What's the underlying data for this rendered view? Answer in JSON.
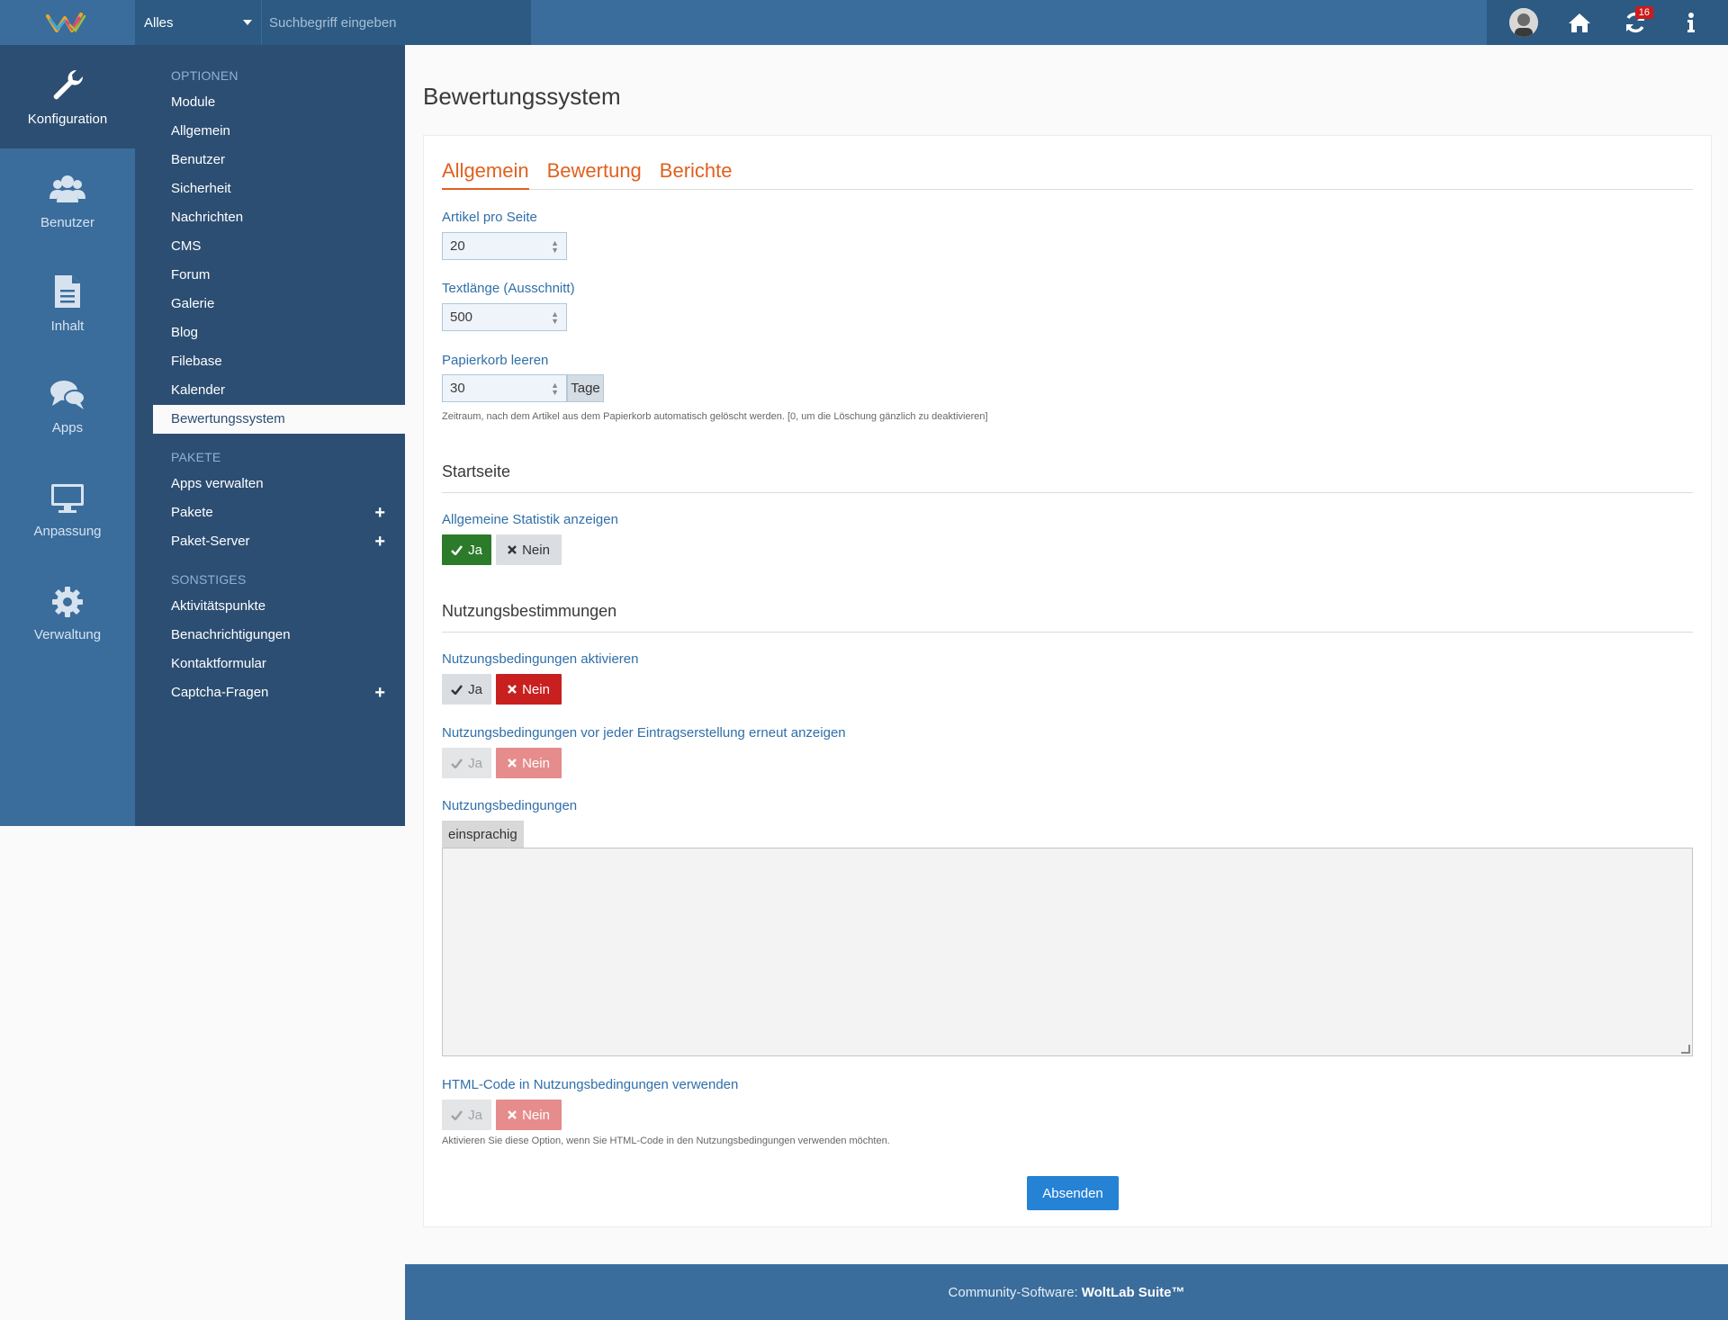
{
  "header": {
    "search_scope": "Alles",
    "search_placeholder": "Suchbegriff eingeben",
    "notification_count": "16"
  },
  "rail": {
    "items": [
      {
        "label": "Konfiguration",
        "icon": "wrench-icon"
      },
      {
        "label": "Benutzer",
        "icon": "users-icon"
      },
      {
        "label": "Inhalt",
        "icon": "file-icon"
      },
      {
        "label": "Apps",
        "icon": "comments-icon"
      },
      {
        "label": "Anpassung",
        "icon": "monitor-icon"
      },
      {
        "label": "Verwaltung",
        "icon": "gear-icon"
      }
    ]
  },
  "subnav": {
    "sections": [
      {
        "title": "OPTIONEN",
        "items": [
          "Module",
          "Allgemein",
          "Benutzer",
          "Sicherheit",
          "Nachrichten",
          "CMS",
          "Forum",
          "Galerie",
          "Blog",
          "Filebase",
          "Kalender",
          "Bewertungssystem"
        ]
      },
      {
        "title": "PAKETE",
        "items": [
          "Apps verwalten",
          "Pakete",
          "Paket-Server"
        ]
      },
      {
        "title": "SONSTIGES",
        "items": [
          "Aktivitätspunkte",
          "Benachrichtigungen",
          "Kontaktformular",
          "Captcha-Fragen"
        ]
      }
    ]
  },
  "page": {
    "title": "Bewertungssystem",
    "tabs": [
      "Allgemein",
      "Bewertung",
      "Berichte"
    ],
    "fields": {
      "artikel_label": "Artikel pro Seite",
      "artikel_value": "20",
      "textlaenge_label": "Textlänge (Ausschnitt)",
      "textlaenge_value": "500",
      "papierkorb_label": "Papierkorb leeren",
      "papierkorb_value": "30",
      "papierkorb_unit": "Tage",
      "papierkorb_desc": "Zeitraum, nach dem Artikel aus dem Papierkorb automatisch gelöscht werden. [0, um die Löschung gänzlich zu deaktivieren]"
    },
    "startseite": {
      "heading": "Startseite",
      "statistik_label": "Allgemeine Statistik anzeigen"
    },
    "nutzung": {
      "heading": "Nutzungsbestimmungen",
      "aktivieren_label": "Nutzungsbedingungen aktivieren",
      "erneut_label": "Nutzungsbedingungen vor jeder Eintragserstellung erneut anzeigen",
      "text_label": "Nutzungsbedingungen",
      "lang_tag": "einsprachig",
      "html_label": "HTML-Code in Nutzungsbedingungen verwenden",
      "html_desc": "Aktivieren Sie diese Option, wenn Sie HTML-Code in den Nutzungsbedingungen verwenden möchten."
    },
    "yes": "Ja",
    "no": "Nein",
    "submit": "Absenden"
  },
  "footer": {
    "prefix": "Community-Software:",
    "brand": "WoltLab Suite™"
  },
  "colors": {
    "header_blue": "#3a6d9c",
    "nav_dark": "#2c4e72",
    "accent_orange": "#e1601f",
    "label_blue": "#2f6fa8",
    "yes_green": "#2c7b2a",
    "no_red": "#c8201f",
    "submit_blue": "#2582d4"
  }
}
